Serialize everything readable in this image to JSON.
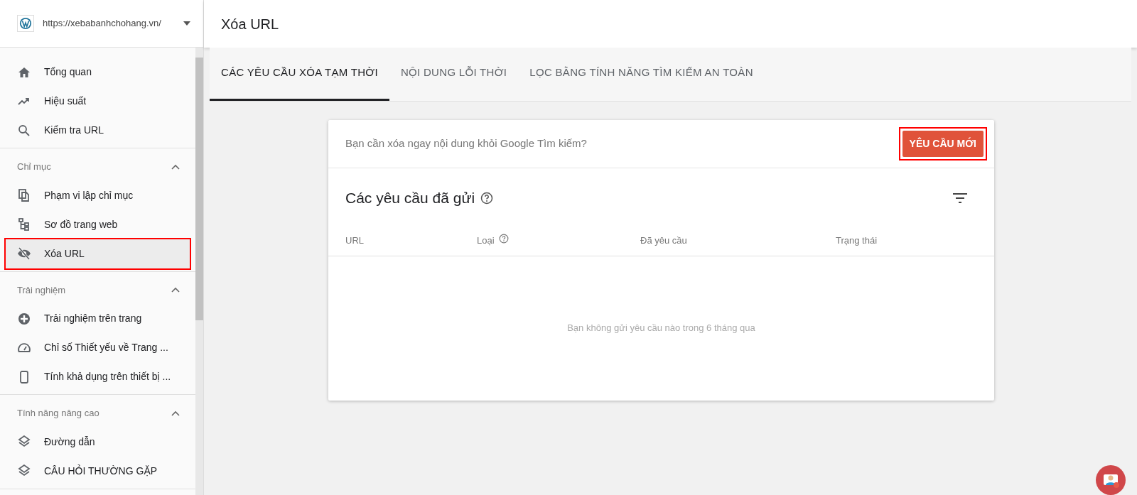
{
  "site": {
    "url": "https://xebabanhchohang.vn/"
  },
  "sidebar": {
    "sections": [
      {
        "items": [
          {
            "label": "Tổng quan",
            "kind": "home",
            "selected": false,
            "highlighted": false
          },
          {
            "label": "Hiệu suất",
            "kind": "trend",
            "selected": false,
            "highlighted": false
          },
          {
            "label": "Kiểm tra URL",
            "kind": "search",
            "selected": false,
            "highlighted": false
          }
        ]
      },
      {
        "title": "Chỉ mục",
        "expanded": true,
        "items": [
          {
            "label": "Phạm vi lập chỉ mục",
            "kind": "copy",
            "selected": false,
            "highlighted": false
          },
          {
            "label": "Sơ đồ trang web",
            "kind": "sitemap",
            "selected": false,
            "highlighted": false
          },
          {
            "label": "Xóa URL",
            "kind": "eyeoff",
            "selected": true,
            "highlighted": true
          }
        ]
      },
      {
        "title": "Trải nghiệm",
        "expanded": true,
        "items": [
          {
            "label": "Trải nghiệm trên trang",
            "kind": "plus",
            "selected": false,
            "highlighted": false
          },
          {
            "label": "Chỉ số Thiết yếu về Trang ...",
            "kind": "gauge",
            "selected": false,
            "highlighted": false
          },
          {
            "label": "Tính khả dụng trên thiết bị ...",
            "kind": "phone",
            "selected": false,
            "highlighted": false
          }
        ]
      },
      {
        "title": "Tính năng nâng cao",
        "expanded": true,
        "items": [
          {
            "label": "Đường dẫn",
            "kind": "layers",
            "selected": false,
            "highlighted": false
          },
          {
            "label": "CÂU HỎI THƯỜNG GẶP",
            "kind": "layers",
            "selected": false,
            "highlighted": false
          }
        ]
      }
    ]
  },
  "page": {
    "title": "Xóa URL"
  },
  "tabs": [
    {
      "label": "CÁC YÊU CẦU XÓA TẠM THỜI",
      "selected": true
    },
    {
      "label": "NỘI DUNG LỖI THỜI",
      "selected": false
    },
    {
      "label": "LỌC BẰNG TÍNH NĂNG TÌM KIẾM AN TOÀN",
      "selected": false
    }
  ],
  "card": {
    "prompt": "Bạn cần xóa ngay nội dung khỏi Google Tìm kiếm?",
    "button": {
      "label": "YÊU CẦU MỚI",
      "highlighted": true
    },
    "section_title": "Các yêu cầu đã gửi",
    "columns": [
      {
        "label": "URL",
        "help": false
      },
      {
        "label": "Loại",
        "help": true
      },
      {
        "label": "Đã yêu cầu",
        "help": false
      },
      {
        "label": "Trạng thái",
        "help": false
      }
    ],
    "empty_message": "Bạn không gửi yêu cầu nào trong 6 tháng qua"
  }
}
